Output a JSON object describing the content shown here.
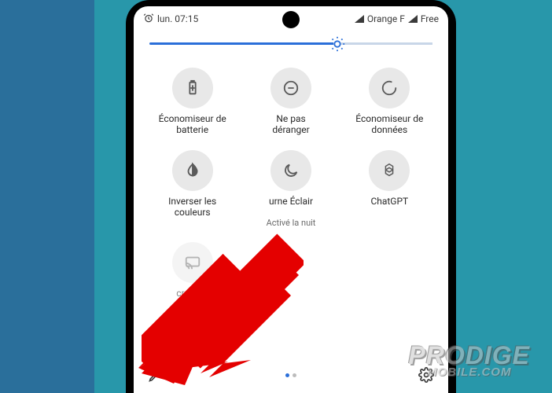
{
  "status": {
    "time_text": "lun. 07:15",
    "carrier1": "Orange F",
    "carrier2": "Free"
  },
  "brightness": {
    "value_pct": 62
  },
  "tiles": [
    {
      "name": "battery-saver-tile",
      "icon": "battery",
      "label": "Économiseur de\nbatterie",
      "sub": ""
    },
    {
      "name": "dnd-tile",
      "icon": "dnd",
      "label": "Ne pas\ndéranger",
      "sub": ""
    },
    {
      "name": "data-saver-tile",
      "icon": "data-saver",
      "label": "Économiseur de\ndonnées",
      "sub": ""
    },
    {
      "name": "invert-colors-tile",
      "icon": "invert",
      "label": "Inverser les\ncouleurs",
      "sub": ""
    },
    {
      "name": "night-light-tile",
      "icon": "moon",
      "label": "urne    Éclair",
      "sub": "Activé la nuit"
    },
    {
      "name": "chatgpt-tile",
      "icon": "chatgpt",
      "label": "ChatGPT",
      "sub": ""
    },
    {
      "name": "cast-tile",
      "icon": "cast",
      "label": "cra         ffus\nect       Wi-Fi",
      "sub": "",
      "faded": true
    }
  ],
  "pager": {
    "total": 2,
    "active": 0
  },
  "watermark": {
    "line1": "PRODIGE",
    "line2": "MOBILE.COM"
  }
}
